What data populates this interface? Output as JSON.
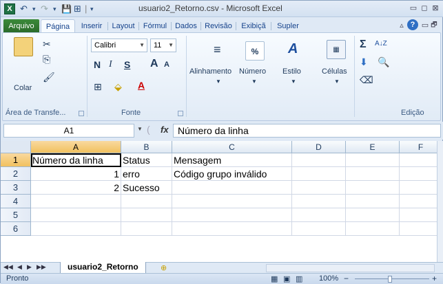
{
  "titlebar": {
    "app_logo": "X",
    "title": "usuario2_Retorno.csv - Microsoft Excel",
    "qat": {
      "undo": "↶",
      "redo": "↷",
      "save": "💾",
      "customize": "⊞",
      "dropdown": "▾"
    },
    "buttons": {
      "minimize": "▭",
      "restore": "◻",
      "close": "⊠"
    }
  },
  "ribbon_tabs": [
    "Arquivo",
    "Página",
    "Inserir",
    "Layout",
    "Fórmul",
    "Dados",
    "Revisão",
    "Exibiçã",
    "Supler"
  ],
  "ribbon_tab_extras": {
    "collapse": "▵",
    "help": "?",
    "min": "▭",
    "restore": "🗗",
    "close": "⊠"
  },
  "ribbon": {
    "clipboard": {
      "paste_label": "Colar",
      "group_label": "Área de Transfe..."
    },
    "font": {
      "font_name": "Calibri",
      "font_size": "11",
      "bold": "N",
      "italic": "I",
      "underline": "S",
      "grow": "A",
      "shrink": "A",
      "group_label": "Fonte"
    },
    "alignment": {
      "label": "Alinhamento"
    },
    "number": {
      "symbol": "%",
      "label": "Número"
    },
    "styles": {
      "label": "Estilo"
    },
    "cells": {
      "label": "Células"
    },
    "editing": {
      "sum": "Σ",
      "sort": "A↓Z",
      "find": "🔍",
      "group_label": "Edição"
    }
  },
  "formula_bar": {
    "name_box": "A1",
    "fx": "fx",
    "formula": "Número da linha"
  },
  "sheet": {
    "columns": [
      "A",
      "B",
      "C",
      "D",
      "E",
      "F"
    ],
    "rows": [
      "1",
      "2",
      "3",
      "4",
      "5",
      "6"
    ],
    "cells": [
      [
        "Número da linha",
        "Status",
        "Mensagem",
        "",
        "",
        ""
      ],
      [
        "1",
        "erro",
        "Código grupo inválido",
        "",
        "",
        ""
      ],
      [
        "2",
        "Sucesso",
        "",
        "",
        "",
        ""
      ],
      [
        "",
        "",
        "",
        "",
        "",
        ""
      ],
      [
        "",
        "",
        "",
        "",
        "",
        ""
      ],
      [
        "",
        "",
        "",
        "",
        "",
        ""
      ]
    ]
  },
  "sheet_tabs": {
    "nav": [
      "◀◀",
      "◀",
      "▶",
      "▶▶"
    ],
    "active": "usuario2_Retorno",
    "new_sheet": "⊕"
  },
  "statusbar": {
    "status": "Pronto",
    "zoom": "100%",
    "zoom_out": "−",
    "zoom_in": "+"
  },
  "colors": {
    "file_tab": "#2a6a2a",
    "selection_header": "#f1c15f",
    "excel_green": "#1e7145"
  }
}
